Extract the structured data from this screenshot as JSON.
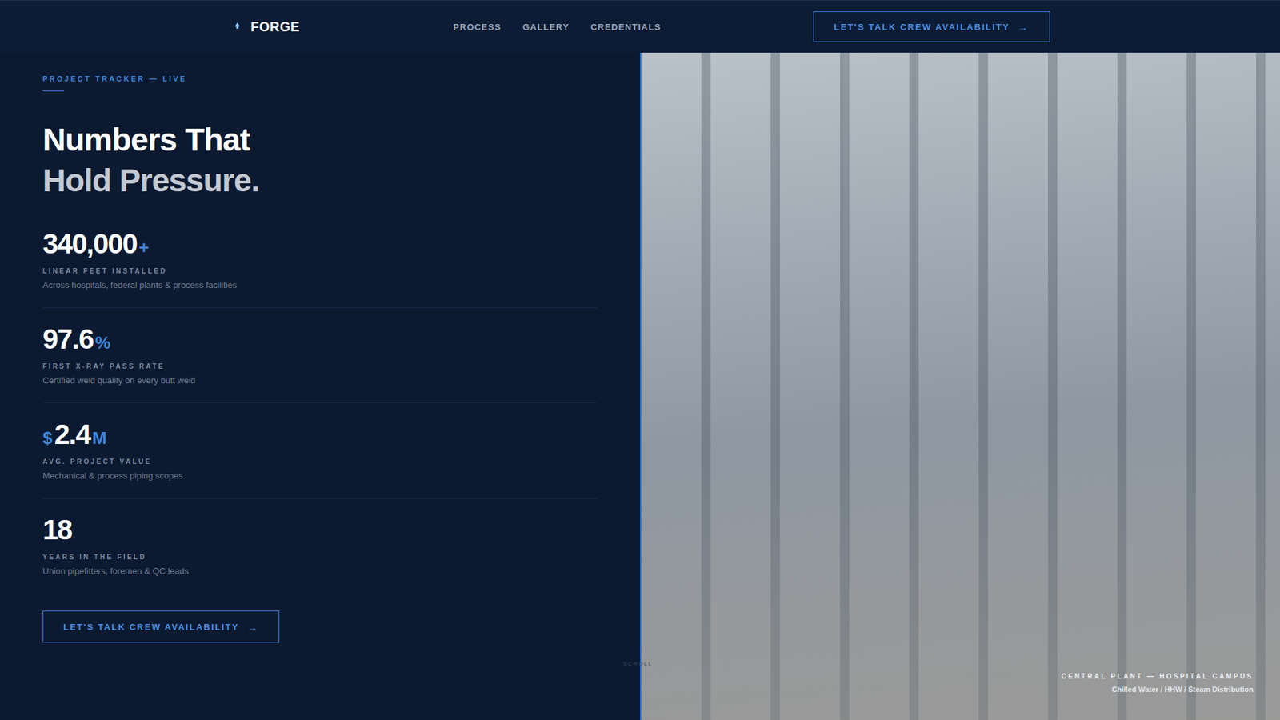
{
  "header": {
    "logo": "FORGE",
    "nav": [
      {
        "label": "PROCESS"
      },
      {
        "label": "GALLERY"
      },
      {
        "label": "CREDENTIALS"
      }
    ],
    "cta": {
      "label": "LET'S TALK CREW AVAILABILITY",
      "icon": "→"
    }
  },
  "eyebrow": "PROJECT TRACKER — LIVE",
  "heading": [
    {
      "text": "Numbers That",
      "muted": false
    },
    {
      "text": "Hold Pressure.",
      "muted": true
    }
  ],
  "stats": [
    {
      "prefix": "",
      "value": "340,000",
      "suffix": "+",
      "label": "LINEAR FEET INSTALLED",
      "description": "Across hospitals, federal plants & process facilities"
    },
    {
      "prefix": "",
      "value": "97.6",
      "suffix": "%",
      "label": "FIRST X-RAY PASS RATE",
      "description": "Certified weld quality on every butt weld"
    },
    {
      "prefix": "$",
      "value": "2.4",
      "suffix": "M",
      "label": "AVG. PROJECT VALUE",
      "description": "Mechanical & process piping scopes"
    },
    {
      "prefix": "",
      "value": "18",
      "suffix": "",
      "label": "YEARS IN THE FIELD",
      "description": "Union pipefitters, foremen & QC leads"
    }
  ],
  "cta": {
    "label": "LET'S TALK CREW AVAILABILITY",
    "icon": "→"
  },
  "scroll": "SCROLL",
  "photo": {
    "caption": "CENTRAL PLANT — HOSPITAL CAMPUS",
    "subcaption": "Chilled Water / HHW / Steam Distribution"
  }
}
